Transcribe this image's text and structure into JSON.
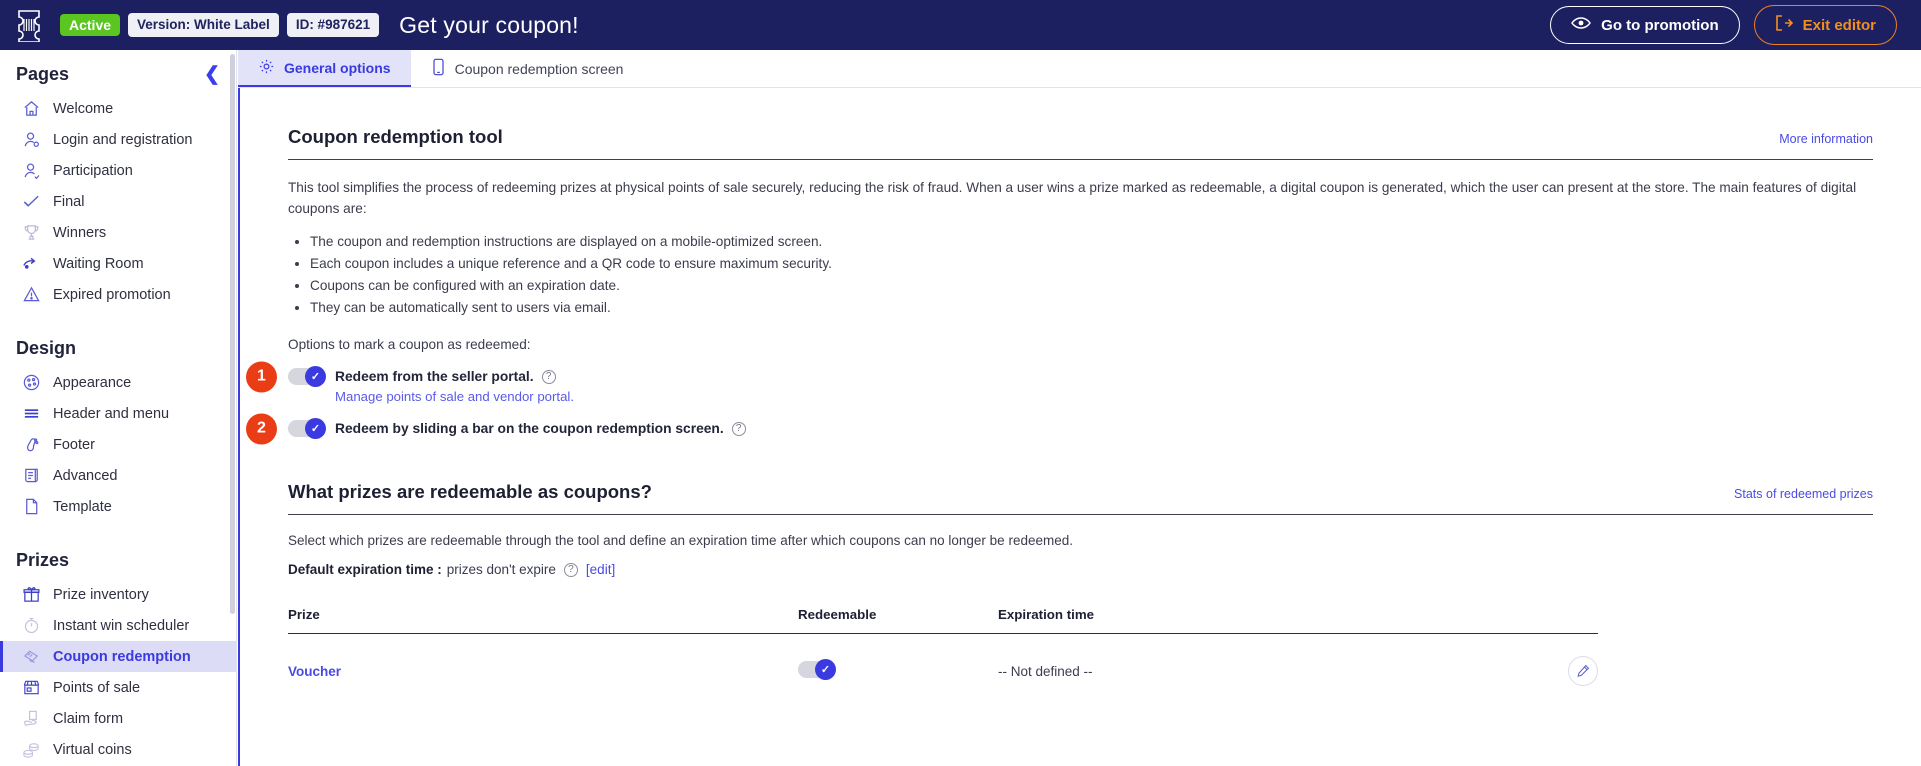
{
  "topbar": {
    "logo_icon": "ticket-icon",
    "status_badge": "Active",
    "version_badge": "Version: White Label",
    "id_badge": "ID: #987621",
    "promotion_title": "Get your coupon!",
    "go_to_promotion": "Go to promotion",
    "go_to_promotion_icon": "eye-icon",
    "exit_editor": "Exit editor",
    "exit_editor_icon": "exit-arrow-icon",
    "accent_active": "#5bc61f",
    "accent_orange": "#f0901e",
    "bar_bg": "#1d2060"
  },
  "sidebar": {
    "collapse_icon": "chevron-left-icon",
    "sections": [
      {
        "title": "Pages",
        "items": [
          {
            "label": "Welcome",
            "icon": "home-icon",
            "active": false
          },
          {
            "label": "Login and registration",
            "icon": "user-login-icon",
            "active": false
          },
          {
            "label": "Participation",
            "icon": "user-add-icon",
            "active": false
          },
          {
            "label": "Final",
            "icon": "check-icon",
            "active": false
          },
          {
            "label": "Winners",
            "icon": "trophy-icon",
            "active": false
          },
          {
            "label": "Waiting Room",
            "icon": "waiting-room-icon",
            "active": false
          },
          {
            "label": "Expired promotion",
            "icon": "warning-triangle-icon",
            "active": false
          }
        ]
      },
      {
        "title": "Design",
        "items": [
          {
            "label": "Appearance",
            "icon": "palette-icon",
            "active": false
          },
          {
            "label": "Header and menu",
            "icon": "menu-lines-icon",
            "active": false
          },
          {
            "label": "Footer",
            "icon": "footprint-icon",
            "active": false
          },
          {
            "label": "Advanced",
            "icon": "scroll-document-icon",
            "active": false
          },
          {
            "label": "Template",
            "icon": "page-icon",
            "active": false
          }
        ]
      },
      {
        "title": "Prizes",
        "items": [
          {
            "label": "Prize inventory",
            "icon": "gift-icon",
            "active": false
          },
          {
            "label": "Instant win scheduler",
            "icon": "stopwatch-icon",
            "active": false
          },
          {
            "label": "Coupon redemption",
            "icon": "coupon-hand-icon",
            "active": true
          },
          {
            "label": "Points of sale",
            "icon": "store-icon",
            "active": false
          },
          {
            "label": "Claim form",
            "icon": "claim-hand-icon",
            "active": false
          },
          {
            "label": "Virtual coins",
            "icon": "coins-icon",
            "active": false
          }
        ]
      }
    ]
  },
  "tabs": [
    {
      "label": "General options",
      "icon": "gear-icon",
      "active": true
    },
    {
      "label": "Coupon redemption screen",
      "icon": "mobile-phone-icon",
      "active": false
    }
  ],
  "main": {
    "section1": {
      "title": "Coupon redemption tool",
      "more_information": "More information",
      "intro": "This tool simplifies the process of redeeming prizes at physical points of sale securely, reducing the risk of fraud. When a user wins a prize marked as redeemable, a digital coupon is generated, which the user can present at the store. The main features of digital coupons are:",
      "features": [
        "The coupon and redemption instructions are displayed on a mobile-optimized screen.",
        "Each coupon includes a unique reference and a QR code to ensure maximum security.",
        "Coupons can be configured with an expiration date.",
        "They can be automatically sent to users via email."
      ],
      "options_label": "Options to mark a coupon as redeemed:",
      "toggles": [
        {
          "badge": "1",
          "label": "Redeem from the seller portal.",
          "checked": true,
          "help_icon": "question-mark-icon",
          "sublink": "Manage points of sale and vendor portal."
        },
        {
          "badge": "2",
          "label": "Redeem by sliding a bar on the coupon redemption screen.",
          "checked": true,
          "help_icon": "question-mark-icon",
          "sublink": ""
        }
      ]
    },
    "section2": {
      "title": "What prizes are redeemable as coupons?",
      "stats_link": "Stats of redeemed prizes",
      "description": "Select which prizes are redeemable through the tool and define an expiration time after which coupons can no longer be redeemed.",
      "default_expiration_label": "Default expiration time :",
      "default_expiration_value": "prizes don't expire",
      "edit_link": "[edit]",
      "help_icon": "question-mark-icon",
      "table": {
        "headers": [
          "Prize",
          "Redeemable",
          "Expiration time",
          ""
        ],
        "rows": [
          {
            "prize": "Voucher",
            "redeemable": true,
            "expiration": "-- Not defined --",
            "action_icon": "pencil-edit-icon"
          }
        ]
      }
    }
  },
  "colors": {
    "primary": "#3a3ae0",
    "badge_red": "#ea3d16",
    "link": "#4a4ae6"
  }
}
